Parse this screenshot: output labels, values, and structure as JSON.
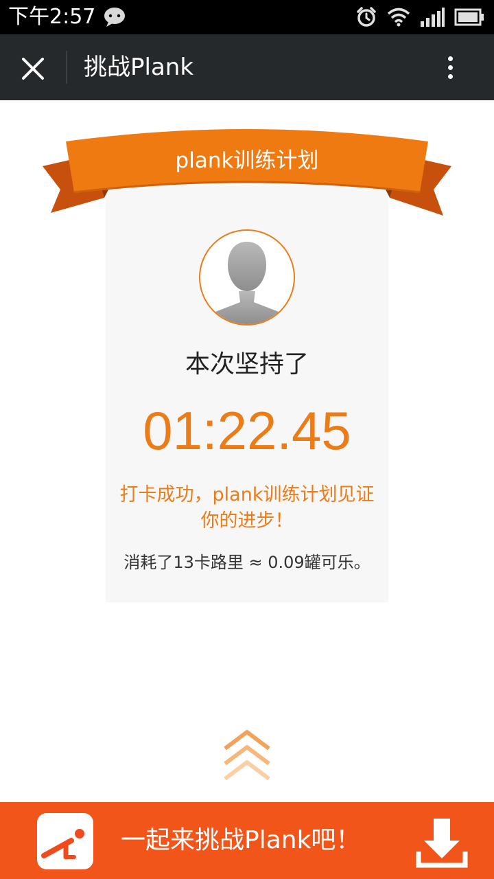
{
  "status_bar": {
    "time": "下午2:57",
    "icons": [
      "wechat-icon",
      "alarm-icon",
      "wifi-icon",
      "signal-icon",
      "battery-icon"
    ]
  },
  "title_bar": {
    "title": "挑战Plank",
    "close_icon": "close-icon",
    "more_icon": "more-vertical-icon"
  },
  "card": {
    "ribbon_title": "plank训练计划",
    "label": "本次坚持了",
    "duration": "01:22.45",
    "success_message": "打卡成功，plank训练计划见证你的进步！",
    "calorie_message": "消耗了13卡路里 ≈ 0.09罐可乐。"
  },
  "bottom_bar": {
    "cta": "一起来挑战Plank吧！",
    "download_icon": "download-icon"
  },
  "colors": {
    "accent": "#ec7c17",
    "bottom_bar": "#f2551a",
    "title_bar": "#25292b",
    "card_bg": "#f7f7f7"
  }
}
